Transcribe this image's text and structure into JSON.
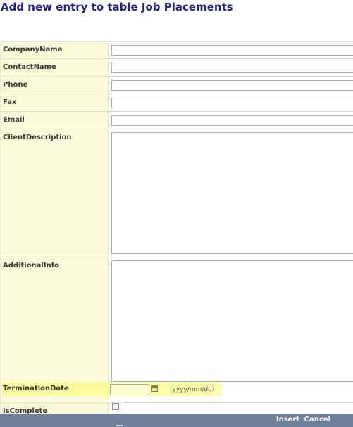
{
  "page": {
    "title": "Add new entry to table Job Placements"
  },
  "form": {
    "fields": [
      {
        "label": "CompanyName",
        "type": "text",
        "value": ""
      },
      {
        "label": "ContactName",
        "type": "text",
        "value": ""
      },
      {
        "label": "Phone",
        "type": "text",
        "value": ""
      },
      {
        "label": "Fax",
        "type": "text",
        "value": ""
      },
      {
        "label": "Email",
        "type": "text",
        "value": ""
      },
      {
        "label": "ClientDescription",
        "type": "textarea",
        "value": ""
      },
      {
        "label": "AdditionalInfo",
        "type": "textarea",
        "value": ""
      },
      {
        "label": "TerminationDate",
        "type": "date",
        "value": "",
        "hint": "(yyyy/mm/dd)"
      },
      {
        "label": "IsComplete",
        "type": "checkbox",
        "checked": false
      }
    ]
  },
  "footer": {
    "insert_label": "Insert",
    "cancel_label": "Cancel"
  },
  "colors": {
    "title": "#1f1f8f",
    "label_background": "#fbfbda",
    "footer_background": "#6e7f99",
    "highlight": "#fcfc8a"
  },
  "icons": {
    "calendar": "calendar-icon"
  }
}
